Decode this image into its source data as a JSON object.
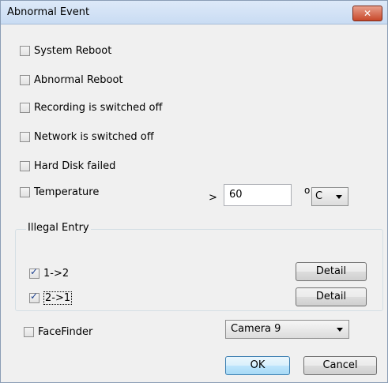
{
  "window": {
    "title": "Abnormal Event",
    "close_label": "✕"
  },
  "events": {
    "system_reboot": {
      "label": "System Reboot",
      "checked": false
    },
    "abnormal_reboot": {
      "label": "Abnormal Reboot",
      "checked": false
    },
    "recording_off": {
      "label": "Recording is switched off",
      "checked": false
    },
    "network_off": {
      "label": "Network is switched off",
      "checked": false
    },
    "hdd_failed": {
      "label": "Hard Disk failed",
      "checked": false
    },
    "temperature": {
      "label": "Temperature",
      "checked": false,
      "operator": ">",
      "value": "60",
      "degree_symbol": "o",
      "unit": "C"
    }
  },
  "illegal_entry": {
    "title": "Illegal Entry",
    "items": [
      {
        "label": "1->2",
        "checked": true,
        "button_label": "Detail"
      },
      {
        "label": "2->1",
        "checked": true,
        "button_label": "Detail"
      }
    ]
  },
  "face_finder": {
    "label": "FaceFinder",
    "checked": false,
    "camera": "Camera 9"
  },
  "footer": {
    "ok_label": "OK",
    "cancel_label": "Cancel"
  }
}
